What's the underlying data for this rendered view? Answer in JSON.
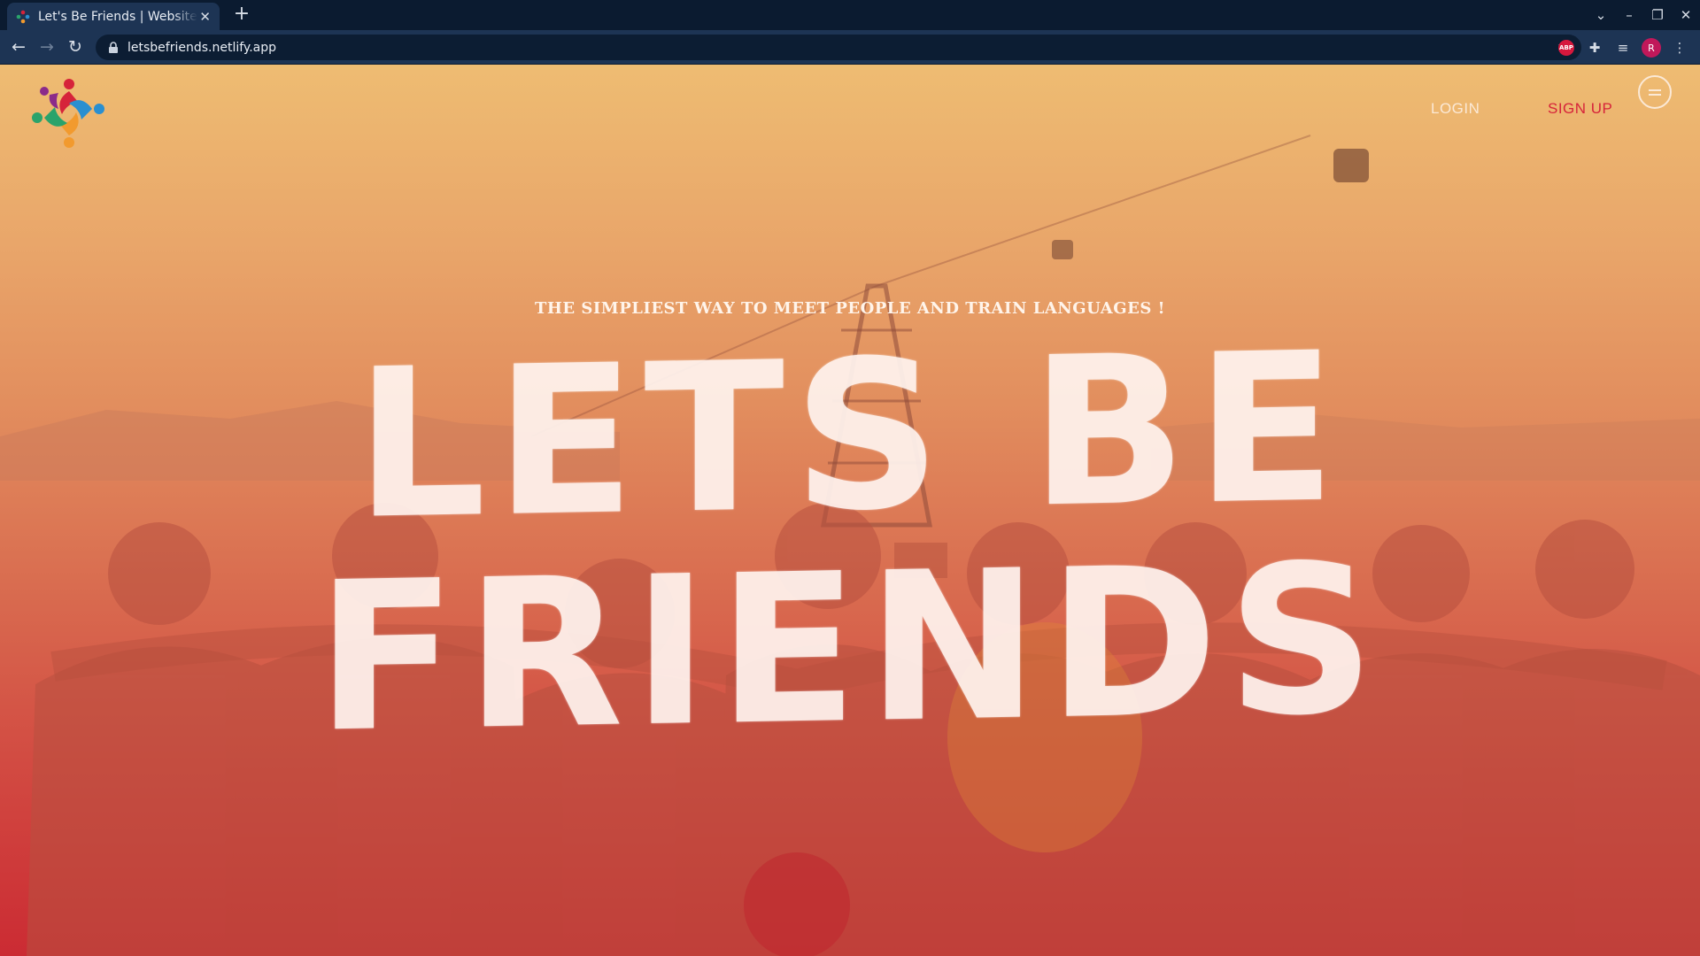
{
  "browser": {
    "tab_title": "Let's Be Friends | Website",
    "tab_close": "✕",
    "new_tab": "+",
    "url": "letsbefriends.netlify.app",
    "profile_initial": "R",
    "abp_label": "ABP",
    "controls": {
      "tab_search": "⌄",
      "minimize": "–",
      "restore": "❐",
      "close": "✕"
    }
  },
  "nav": {
    "login": "LOGIN",
    "signup": "SIGN UP"
  },
  "hero": {
    "tagline": "THE SIMPLIEST WAY TO MEET PEOPLE AND TRAIN LANGUAGES !",
    "title": "LETS BE FRIENDS"
  },
  "colors": {
    "signup_accent": "#d6233a",
    "gradient_top": "#eebc72",
    "gradient_bottom": "#cb2b33"
  }
}
